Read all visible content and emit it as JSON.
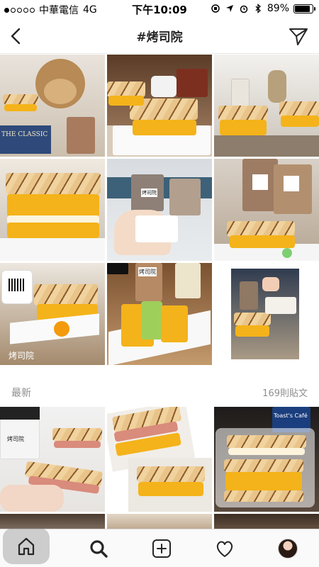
{
  "status_bar": {
    "carrier": "中華電信",
    "network": "4G",
    "time": "下午10:09",
    "battery": "89%",
    "battery_level": 0.89
  },
  "nav": {
    "title": "#烤司院"
  },
  "top_posts": [
    {
      "label": "THE CLASSIC"
    },
    {
      "label": ""
    },
    {
      "label": ""
    },
    {
      "label": ""
    },
    {
      "label": "烤司院"
    },
    {
      "label": ""
    },
    {
      "label": "烤司院"
    },
    {
      "label": "烤司院"
    },
    {
      "label": ""
    }
  ],
  "recent_section": {
    "title": "最新",
    "count": "169則貼文"
  },
  "recent_posts": [
    {
      "label": "烤司院"
    },
    {
      "label": ""
    },
    {
      "label": "Toast's Café"
    }
  ],
  "tab_bar": {
    "items": [
      "home-icon",
      "search-icon",
      "add-post-icon",
      "heart-icon",
      "profile-avatar"
    ]
  },
  "colors": {
    "accent": "#262626",
    "divider": "#dbdbdb",
    "muted_text": "#8e8e8e"
  }
}
